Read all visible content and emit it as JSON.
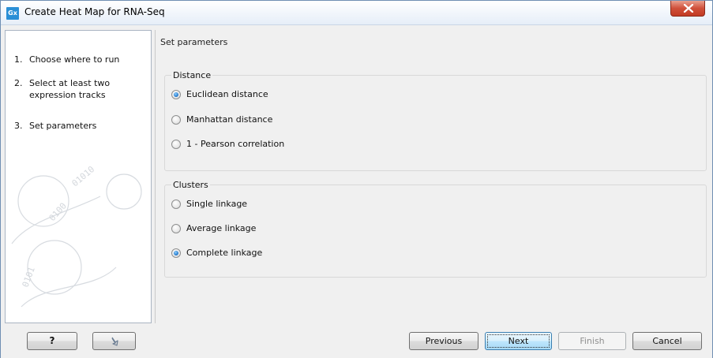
{
  "window": {
    "title": "Create Heat Map for RNA-Seq",
    "app_icon_text": "Gx"
  },
  "steps": [
    {
      "num": "1.",
      "label": "Choose where to run"
    },
    {
      "num": "2.",
      "label": "Select at least two expression tracks"
    },
    {
      "num": "3.",
      "label": "Set parameters"
    }
  ],
  "main": {
    "section_title": "Set parameters",
    "distance": {
      "legend": "Distance",
      "options": [
        {
          "label": "Euclidean distance",
          "checked": true
        },
        {
          "label": "Manhattan distance",
          "checked": false
        },
        {
          "label": "1 - Pearson correlation",
          "checked": false
        }
      ]
    },
    "clusters": {
      "legend": "Clusters",
      "options": [
        {
          "label": "Single linkage",
          "checked": false
        },
        {
          "label": "Average linkage",
          "checked": false
        },
        {
          "label": "Complete linkage",
          "checked": true
        }
      ]
    }
  },
  "buttons": {
    "help": "?",
    "reset_icon": "reset-arrow-icon",
    "previous": "Previous",
    "next": "Next",
    "finish": "Finish",
    "cancel": "Cancel"
  },
  "colors": {
    "title_bar": "#e6eef8",
    "close_red": "#c23b23",
    "radio_selected": "#2b7fd0",
    "default_button": "#bee6fd"
  }
}
